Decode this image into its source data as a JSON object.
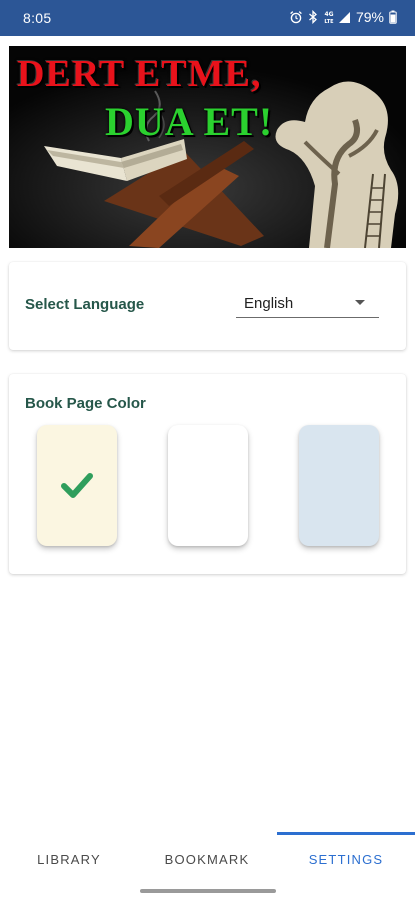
{
  "status_bar": {
    "time": "8:05",
    "network": "4G LTE",
    "battery": "79%"
  },
  "banner": {
    "line1": "DERT ETME,",
    "line2": "DUA ET!"
  },
  "language": {
    "label": "Select Language",
    "value": "English"
  },
  "page_color": {
    "label": "Book Page Color",
    "swatches": [
      {
        "color": "#fbf6e1",
        "selected": true
      },
      {
        "color": "#ffffff",
        "selected": false
      },
      {
        "color": "#d9e5ef",
        "selected": false
      }
    ],
    "check_color": "#2f9e5c"
  },
  "bottom_nav": {
    "tabs": [
      {
        "label": "LIBRARY"
      },
      {
        "label": "BOOKMARK"
      },
      {
        "label": "SETTINGS"
      }
    ],
    "active": "SETTINGS",
    "accent": "#2c6fd0"
  }
}
